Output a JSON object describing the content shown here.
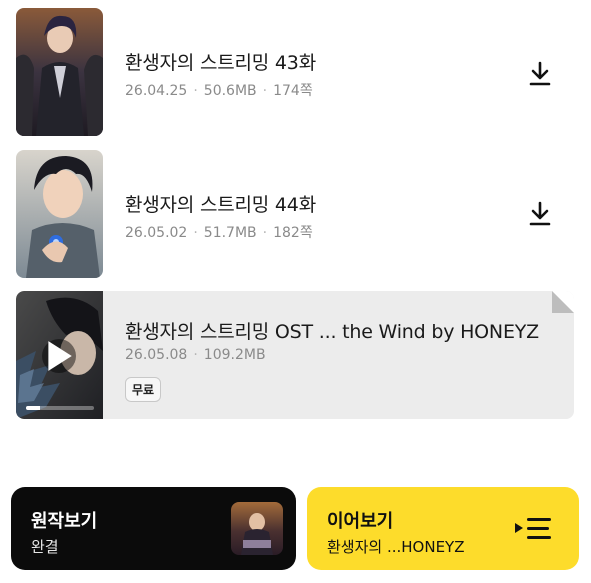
{
  "episodes": [
    {
      "title": "환생자의 스트리밍 43화",
      "date": "26.04.25",
      "size": "50.6MB",
      "pages": "174쪽",
      "download_icon": "download-icon"
    },
    {
      "title": "환생자의 스트리밍 44화",
      "date": "26.05.02",
      "size": "51.7MB",
      "pages": "182쪽",
      "download_icon": "download-icon"
    }
  ],
  "ost": {
    "title": "환생자의 스트리밍 OST ... the Wind by HONEYZ",
    "date": "26.05.08",
    "size": "109.2MB",
    "badge": "무료",
    "play_icon": "play-icon",
    "progress": 0.2
  },
  "bottom": {
    "original": {
      "title": "원작보기",
      "subtitle": "완결"
    },
    "continue": {
      "title": "이어보기",
      "subtitle": "환생자의 ...HONEYZ",
      "icon": "playlist-play-icon"
    }
  },
  "colors": {
    "continue_bg": "#fddc2b",
    "original_bg": "#0b0b0b",
    "ost_bg": "#ececec",
    "meta_text": "#8a8a8a"
  }
}
